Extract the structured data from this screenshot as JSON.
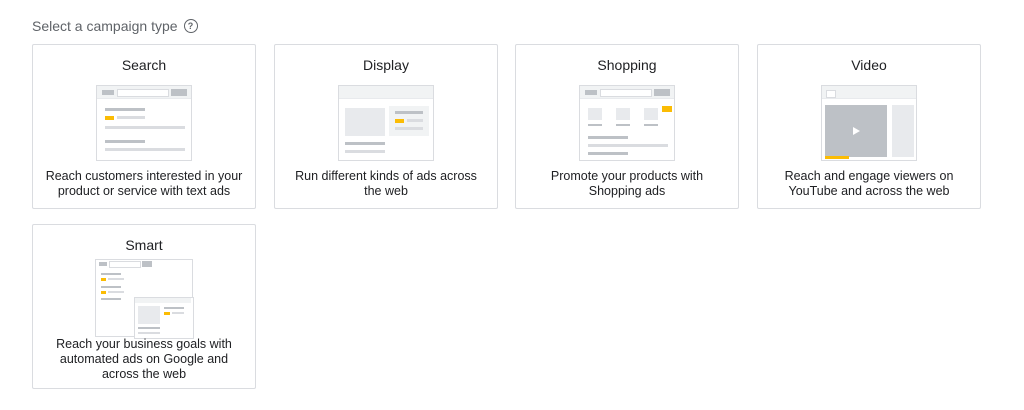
{
  "header": {
    "label": "Select a campaign type",
    "help_icon": "help-circle-icon"
  },
  "campaigns": [
    {
      "title": "Search",
      "description": "Reach customers interested in your product or service with text ads",
      "illustration": "search-ad-illustration"
    },
    {
      "title": "Display",
      "description": "Run different kinds of ads across the web",
      "illustration": "display-ad-illustration"
    },
    {
      "title": "Shopping",
      "description": "Promote your products with Shopping ads",
      "illustration": "shopping-ad-illustration"
    },
    {
      "title": "Video",
      "description": "Reach and engage viewers on YouTube and across the web",
      "illustration": "video-ad-illustration"
    },
    {
      "title": "Smart",
      "description": "Reach your business goals with automated ads on Google and across the web",
      "illustration": "smart-ad-illustration"
    }
  ],
  "colors": {
    "accent": "#fbbc04",
    "border": "#dadce0",
    "text": "#202124",
    "muted": "#5f6368"
  }
}
